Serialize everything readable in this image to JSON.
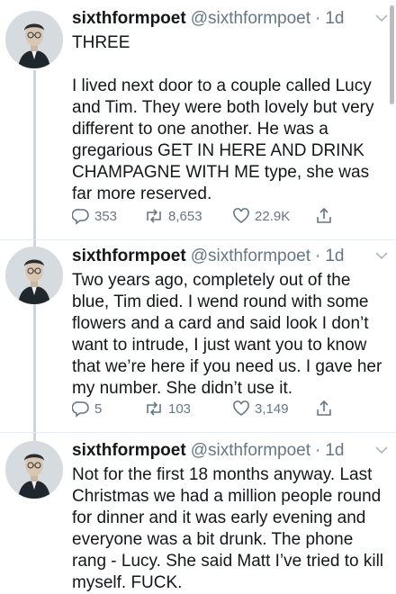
{
  "tweets": [
    {
      "name": "sixthformpoet",
      "handle": "@sixthformpoet",
      "sep": "·",
      "time": "1d",
      "text": "THREE\n\nI lived next door to a couple called Lucy and Tim. They were both lovely but very different to one another. He was a gregarious GET IN HERE AND DRINK CHAMPAGNE WITH ME type, she was far more reserved.",
      "replies": "353",
      "retweets": "8,653",
      "likes": "22.9K"
    },
    {
      "name": "sixthformpoet",
      "handle": "@sixthformpoet",
      "sep": "·",
      "time": "1d",
      "text": "Two years ago, completely out of the blue, Tim died. I wend round with some flowers and a card and said look I don’t want to intrude, I just want you to know that we’re here if you need us. I gave her my number. She didn’t use it.",
      "replies": "5",
      "retweets": "103",
      "likes": "3,149"
    },
    {
      "name": "sixthformpoet",
      "handle": "@sixthformpoet",
      "sep": "·",
      "time": "1d",
      "text": "Not for the first 18 months anyway. Last Christmas we had a million people round for dinner and it was early evening and everyone was a bit drunk. The phone rang - Lucy. She said Matt I’ve tried to kill myself. FUCK."
    }
  ],
  "icons": {
    "reply": "reply-icon",
    "retweet": "retweet-icon",
    "like": "heart-icon",
    "share": "share-icon",
    "chevron": "chevron-down-icon"
  },
  "colors": {
    "text": "#14171a",
    "secondary": "#657786",
    "thread_line": "#ccd6dd",
    "divider": "#e6ecf0"
  }
}
